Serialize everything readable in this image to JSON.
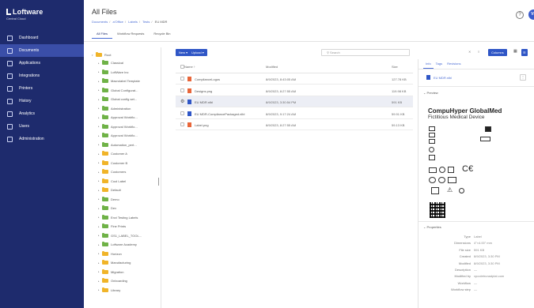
{
  "brand": {
    "logo": "Loftware",
    "sub": "Central Cloud"
  },
  "nav": [
    "Dashboard",
    "Documents",
    "Applications",
    "Integrations",
    "Printers",
    "History",
    "Analytics",
    "Users",
    "Administration"
  ],
  "header": {
    "title": "All Files",
    "breadcrumbs": [
      "Documents",
      "a'Office",
      "Labels",
      "Tests",
      "EU MDR"
    ],
    "tabs": [
      "All Files",
      "Workflow Requests",
      "Recycle Bin"
    ],
    "help_icon": "?",
    "avatar": "VP"
  },
  "tree": {
    "root": "Root",
    "items": [
      "Classical",
      "LoftWare Inc",
      "Macrolabel Template",
      "Global Configurat...",
      "Global config set...",
      "Administration",
      "Approval Workflo...",
      "Approval Workflo...",
      "Approval Workflo...",
      "Automation_pert...",
      "Customer A",
      "Customer B",
      "Customers",
      "Cool Label",
      "Default",
      "Demo",
      "Dev",
      "Envi Testing Labels",
      "Fine Prints",
      "GS1_LABEL_TOOL...",
      "Loftware Academy",
      "Horizon",
      "Manufacturing",
      "Migration",
      "Onboarding",
      "Library"
    ]
  },
  "toolbar": {
    "new_label": "New ▾",
    "upload_label": "Upload ▾",
    "search_placeholder": "Search",
    "columns_label": "Columns"
  },
  "table": {
    "headers": {
      "name": "Name ↑",
      "modified": "Modified",
      "size": "Size"
    },
    "rows": [
      {
        "name": "ComplianceLogos",
        "modified": "8/9/2023, 8:43:05 AM",
        "size": "127.78 KB",
        "icon": "orange"
      },
      {
        "name": "Designs.png",
        "modified": "8/9/2023, 8:27:55 AM",
        "size": "119.98 KB",
        "icon": "orange"
      },
      {
        "name": "EU MDR.nlbl",
        "modified": "8/9/2023, 3:30:54 PM",
        "size": "591 KB",
        "icon": "blue",
        "selected": true
      },
      {
        "name": "EU MDR-CompliancePackaged.nlbl",
        "modified": "8/9/2023, 9:17:24 AM",
        "size": "59.91 KB",
        "icon": "blue"
      },
      {
        "name": "Label.png",
        "modified": "8/9/2023, 8:27:55 AM",
        "size": "59.13 KB",
        "icon": "orange"
      }
    ]
  },
  "panel": {
    "tabs": [
      "Info",
      "Tags",
      "Revisions"
    ],
    "file_name": "EU MDR.nlbl",
    "preview_heading": "Preview",
    "label": {
      "company": "CompuHyper GlobalMed",
      "device": "Fictitious Medical Device"
    },
    "properties_heading": "Properties",
    "properties": [
      {
        "k": "Type",
        "v": "Label"
      },
      {
        "k": "Dimensions",
        "v": "4\"×4.00\" mm"
      },
      {
        "k": "File size",
        "v": "591 KB"
      },
      {
        "k": "Created",
        "v": "8/9/2023, 3:30 PM"
      },
      {
        "k": "Modified",
        "v": "8/9/2023, 3:30 PM"
      },
      {
        "k": "Description",
        "v": "—"
      },
      {
        "k": "Modified by",
        "v": "vpooletrunadplat.com"
      },
      {
        "k": "Workflow",
        "v": "—"
      },
      {
        "k": "Workflow step",
        "v": "—"
      }
    ]
  },
  "colors": {
    "nav_bg": "#1e2b6d",
    "accent": "#2f56c6",
    "folder": "#f0b429"
  }
}
